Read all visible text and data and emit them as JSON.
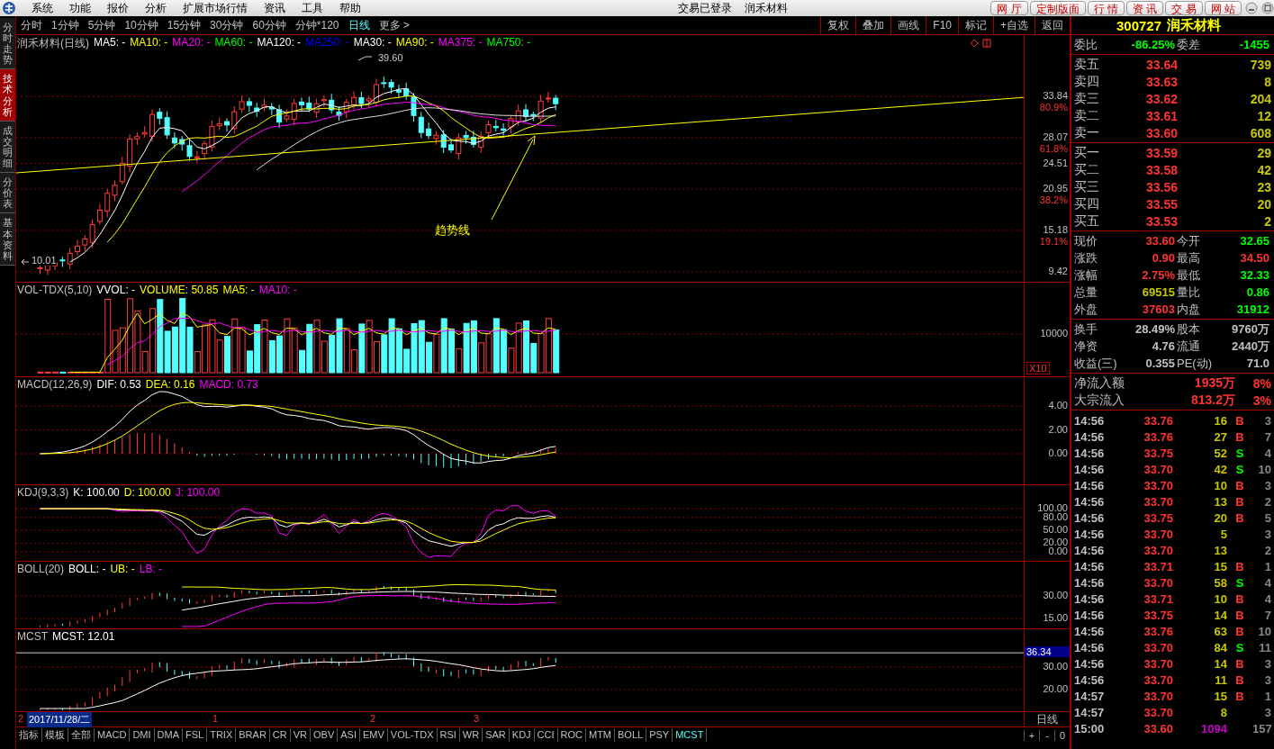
{
  "menu": [
    "系统",
    "功能",
    "报价",
    "分析",
    "扩展市场行情",
    "资讯",
    "工具",
    "帮助"
  ],
  "status": {
    "login": "交易已登录",
    "stock": "润禾材料"
  },
  "top_buttons": [
    "网 厅",
    "定制版面",
    "行 情",
    "资 讯",
    "交 易",
    "网 站"
  ],
  "side_tabs": [
    {
      "label": "分时走势",
      "selected": false
    },
    {
      "label": "技术分析",
      "selected": true
    },
    {
      "label": "成交明细",
      "selected": false
    },
    {
      "label": "分价表",
      "selected": false
    },
    {
      "label": "基本资料",
      "selected": false
    }
  ],
  "periods": [
    {
      "label": "分时",
      "selected": false
    },
    {
      "label": "1分钟",
      "selected": false
    },
    {
      "label": "5分钟",
      "selected": false
    },
    {
      "label": "10分钟",
      "selected": false
    },
    {
      "label": "15分钟",
      "selected": false
    },
    {
      "label": "30分钟",
      "selected": false
    },
    {
      "label": "60分钟",
      "selected": false
    },
    {
      "label": "分钟*120",
      "selected": false
    },
    {
      "label": "日线",
      "selected": true
    },
    {
      "label": "更多 >",
      "selected": false
    }
  ],
  "tools": [
    "复权",
    "叠加",
    "画线",
    "F10",
    "标记",
    "+自选",
    "返回"
  ],
  "panels": [
    {
      "kind": "main",
      "title": "润禾材料(日线)",
      "legend": [
        {
          "text": "MA5: -",
          "color": "#ffffff"
        },
        {
          "text": "MA10: -",
          "color": "#ffff00"
        },
        {
          "text": "MA20: -",
          "color": "#ff00ff"
        },
        {
          "text": "MA60: -",
          "color": "#00ff00"
        },
        {
          "text": "MA120: -",
          "color": "#ffffff"
        },
        {
          "text": "MA250: -",
          "color": "#0000ff"
        },
        {
          "text": "MA30: -",
          "color": "#ffffff"
        },
        {
          "text": "MA90: -",
          "color": "#ffff00"
        },
        {
          "text": "MA375: -",
          "color": "#ff00ff"
        },
        {
          "text": "MA750: -",
          "color": "#00ff00"
        }
      ],
      "axis": [
        {
          "label": "33.84",
          "note": "80.9%",
          "current": false
        },
        {
          "label": "28.07",
          "note": "61.8%",
          "current": false
        },
        {
          "label": "24.51",
          "current": false
        },
        {
          "label": "20.95",
          "note": "38.2%",
          "current": false
        },
        {
          "label": "15.18",
          "note": "19.1%",
          "current": false
        },
        {
          "label": "9.42",
          "current": false
        }
      ],
      "high_label": "39.60",
      "low_label": "10.01",
      "trendline_label": "趋势线"
    },
    {
      "kind": "volume",
      "title": "VOL-TDX(5,10)",
      "legend": [
        {
          "text": "VVOL: -",
          "color": "#ffffff"
        },
        {
          "text": "VOLUME: 50.85",
          "color": "#ffff00"
        },
        {
          "text": "MA5: -",
          "color": "#ffff00"
        },
        {
          "text": "MA10: -",
          "color": "#ff00ff"
        }
      ],
      "axis": [
        {
          "label": "10000",
          "current": false
        }
      ],
      "unit": "X10"
    },
    {
      "kind": "macd",
      "title": "MACD(12,26,9)",
      "legend": [
        {
          "text": "DIF: 0.53",
          "color": "#ffffff"
        },
        {
          "text": "DEA: 0.16",
          "color": "#ffff00"
        },
        {
          "text": "MACD: 0.73",
          "color": "#ff00ff"
        }
      ],
      "axis": [
        {
          "label": "4.00",
          "current": false
        },
        {
          "label": "2.00",
          "current": false
        },
        {
          "label": "0.00",
          "current": false
        }
      ]
    },
    {
      "kind": "kdj",
      "title": "KDJ(9,3,3)",
      "legend": [
        {
          "text": "K: 100.00",
          "color": "#ffffff"
        },
        {
          "text": "D: 100.00",
          "color": "#ffff00"
        },
        {
          "text": "J: 100.00",
          "color": "#ff00ff"
        }
      ],
      "axis": [
        {
          "label": "100.00",
          "current": false
        },
        {
          "label": "80.00",
          "current": false
        },
        {
          "label": "50.00",
          "current": false
        },
        {
          "label": "20.00",
          "current": false
        },
        {
          "label": "0.00",
          "current": false
        }
      ]
    },
    {
      "kind": "boll",
      "title": "BOLL(20)",
      "legend": [
        {
          "text": "BOLL: -",
          "color": "#ffffff"
        },
        {
          "text": "UB: -",
          "color": "#ffff00"
        },
        {
          "text": "LB: -",
          "color": "#ff00ff"
        }
      ],
      "axis": [
        {
          "label": "30.00",
          "current": false
        },
        {
          "label": "15.00",
          "current": false
        }
      ]
    },
    {
      "kind": "mcst",
      "title": "MCST",
      "legend": [
        {
          "text": "MCST: 12.01",
          "color": "#ffffff"
        }
      ],
      "axis": [
        {
          "label": "36.34",
          "current": true
        },
        {
          "label": "30.00",
          "current": false
        },
        {
          "label": "20.00",
          "current": false
        }
      ]
    }
  ],
  "date_bar": {
    "start": "2",
    "cursor_date": "2017/11/28/二",
    "months": [
      "1",
      "2",
      "3"
    ],
    "period": "日线"
  },
  "indicator_tabs": [
    {
      "label": "指标",
      "selected": false
    },
    {
      "label": "模板",
      "selected": false
    },
    {
      "label": "全部",
      "selected": false
    },
    {
      "label": "MACD",
      "selected": false
    },
    {
      "label": "DMI",
      "selected": false
    },
    {
      "label": "DMA",
      "selected": false
    },
    {
      "label": "FSL",
      "selected": false
    },
    {
      "label": "TRIX",
      "selected": false
    },
    {
      "label": "BRAR",
      "selected": false
    },
    {
      "label": "CR",
      "selected": false
    },
    {
      "label": "VR",
      "selected": false
    },
    {
      "label": "OBV",
      "selected": false
    },
    {
      "label": "ASI",
      "selected": false
    },
    {
      "label": "EMV",
      "selected": false
    },
    {
      "label": "VOL-TDX",
      "selected": false
    },
    {
      "label": "RSI",
      "selected": false
    },
    {
      "label": "WR",
      "selected": false
    },
    {
      "label": "SAR",
      "selected": false
    },
    {
      "label": "KDJ",
      "selected": false
    },
    {
      "label": "CCI",
      "selected": false
    },
    {
      "label": "ROC",
      "selected": false
    },
    {
      "label": "MTM",
      "selected": false
    },
    {
      "label": "BOLL",
      "selected": false
    },
    {
      "label": "PSY",
      "selected": false
    },
    {
      "label": "MCST",
      "selected": true
    }
  ],
  "zoom_buttons": [
    "+",
    "-",
    "0"
  ],
  "quote": {
    "code": "300727",
    "name": "润禾材料",
    "ratio": [
      {
        "label": "委比",
        "value": "-86.25%",
        "color": "#00ff00"
      },
      {
        "label": "委差",
        "value": "-1455",
        "color": "#00ff00"
      }
    ],
    "asks": [
      {
        "label": "卖五",
        "price": "33.64",
        "volume": "739"
      },
      {
        "label": "卖四",
        "price": "33.63",
        "volume": "8"
      },
      {
        "label": "卖三",
        "price": "33.62",
        "volume": "204"
      },
      {
        "label": "卖二",
        "price": "33.61",
        "volume": "12"
      },
      {
        "label": "卖一",
        "price": "33.60",
        "volume": "608"
      }
    ],
    "bids": [
      {
        "label": "买一",
        "price": "33.59",
        "volume": "29"
      },
      {
        "label": "买二",
        "price": "33.58",
        "volume": "42"
      },
      {
        "label": "买三",
        "price": "33.56",
        "volume": "23"
      },
      {
        "label": "买四",
        "price": "33.55",
        "volume": "20"
      },
      {
        "label": "买五",
        "price": "33.53",
        "volume": "2"
      }
    ],
    "stats": [
      [
        {
          "label": "现价",
          "value": "33.60",
          "color": "#ff3232"
        },
        {
          "label": "今开",
          "value": "32.65",
          "color": "#00ff00"
        }
      ],
      [
        {
          "label": "涨跌",
          "value": "0.90",
          "color": "#ff3232"
        },
        {
          "label": "最高",
          "value": "34.50",
          "color": "#ff3232"
        }
      ],
      [
        {
          "label": "涨幅",
          "value": "2.75%",
          "color": "#ff3232"
        },
        {
          "label": "最低",
          "value": "32.33",
          "color": "#00ff00"
        }
      ],
      [
        {
          "label": "总量",
          "value": "69515",
          "color": "#c8c800"
        },
        {
          "label": "量比",
          "value": "0.86",
          "color": "#00ff00"
        }
      ],
      [
        {
          "label": "外盘",
          "value": "37603",
          "color": "#ff3232"
        },
        {
          "label": "内盘",
          "value": "31912",
          "color": "#00ff00"
        }
      ]
    ],
    "finance": [
      [
        {
          "label": "换手",
          "value": "28.49%",
          "color": "#c0c0c0"
        },
        {
          "label": "股本",
          "value": "9760万",
          "color": "#c0c0c0"
        }
      ],
      [
        {
          "label": "净资",
          "value": "4.76",
          "color": "#c0c0c0"
        },
        {
          "label": "流通",
          "value": "2440万",
          "color": "#c0c0c0"
        }
      ],
      [
        {
          "label": "收益(三)",
          "value": "0.355",
          "color": "#c0c0c0"
        },
        {
          "label": "PE(动)",
          "value": "71.0",
          "color": "#c0c0c0"
        }
      ]
    ],
    "flows": [
      {
        "label": "净流入额",
        "value": "1935万",
        "percent": "8%"
      },
      {
        "label": "大宗流入",
        "value": "813.2万",
        "percent": "3%"
      }
    ]
  },
  "trades": [
    {
      "time": "14:56",
      "price": "33.76",
      "volume": "16",
      "side": "B",
      "kind": "buy",
      "count": "3",
      "highlight": false
    },
    {
      "time": "14:56",
      "price": "33.76",
      "volume": "27",
      "side": "B",
      "kind": "buy",
      "count": "7",
      "highlight": false
    },
    {
      "time": "14:56",
      "price": "33.75",
      "volume": "52",
      "side": "S",
      "kind": "sell",
      "count": "4",
      "highlight": false
    },
    {
      "time": "14:56",
      "price": "33.70",
      "volume": "42",
      "side": "S",
      "kind": "sell",
      "count": "10",
      "highlight": false
    },
    {
      "time": "14:56",
      "price": "33.70",
      "volume": "10",
      "side": "B",
      "kind": "buy",
      "count": "3",
      "highlight": false
    },
    {
      "time": "14:56",
      "price": "33.70",
      "volume": "13",
      "side": "B",
      "kind": "buy",
      "count": "2",
      "highlight": false
    },
    {
      "time": "14:56",
      "price": "33.75",
      "volume": "20",
      "side": "B",
      "kind": "buy",
      "count": "5",
      "highlight": false
    },
    {
      "time": "14:56",
      "price": "33.70",
      "volume": "5",
      "kind": "none",
      "count": "3",
      "highlight": false
    },
    {
      "time": "14:56",
      "price": "33.70",
      "volume": "13",
      "kind": "none",
      "count": "2",
      "highlight": false
    },
    {
      "time": "14:56",
      "price": "33.71",
      "volume": "15",
      "side": "B",
      "kind": "buy",
      "count": "1",
      "highlight": false
    },
    {
      "time": "14:56",
      "price": "33.70",
      "volume": "58",
      "side": "S",
      "kind": "sell",
      "count": "4",
      "highlight": false
    },
    {
      "time": "14:56",
      "price": "33.71",
      "volume": "10",
      "side": "B",
      "kind": "buy",
      "count": "4",
      "highlight": false
    },
    {
      "time": "14:56",
      "price": "33.75",
      "volume": "14",
      "side": "B",
      "kind": "buy",
      "count": "7",
      "highlight": false
    },
    {
      "time": "14:56",
      "price": "33.76",
      "volume": "63",
      "side": "B",
      "kind": "buy",
      "count": "10",
      "highlight": false
    },
    {
      "time": "14:56",
      "price": "33.70",
      "volume": "84",
      "side": "S",
      "kind": "sell",
      "count": "11",
      "highlight": false
    },
    {
      "time": "14:56",
      "price": "33.70",
      "volume": "14",
      "side": "B",
      "kind": "buy",
      "count": "3",
      "highlight": false
    },
    {
      "time": "14:56",
      "price": "33.70",
      "volume": "11",
      "side": "B",
      "kind": "buy",
      "count": "3",
      "highlight": false
    },
    {
      "time": "14:57",
      "price": "33.70",
      "volume": "15",
      "side": "B",
      "kind": "buy",
      "count": "1",
      "highlight": false
    },
    {
      "time": "14:57",
      "price": "33.70",
      "volume": "8",
      "kind": "none",
      "count": "3",
      "highlight": false
    },
    {
      "time": "15:00",
      "price": "33.60",
      "volume": "1094",
      "kind": "none",
      "count": "157",
      "highlight": true
    }
  ]
}
